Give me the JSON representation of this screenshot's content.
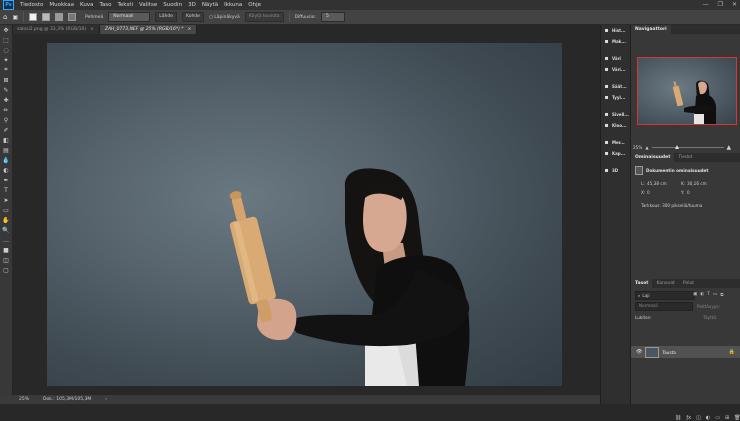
{
  "app": {
    "logo": "Ps"
  },
  "menu": [
    "Tiedosto",
    "Muokkaa",
    "Kuva",
    "Taso",
    "Teksti",
    "Valitse",
    "Suodin",
    "3D",
    "Näytä",
    "Ikkuna",
    "Ohje"
  ],
  "window_controls": {
    "minimize": "—",
    "restore": "❐",
    "close": "✕"
  },
  "options": {
    "blend_label": "Pehmeä",
    "mode_value": "Normaali",
    "btn1": "Lähde",
    "btn2": "Kohde",
    "transparent_label": "Läpinäkyvä",
    "pattern_label": "Käytä kuviota",
    "diffusion_label": "Diffuusio:",
    "diffusion_value": "5"
  },
  "tabs": [
    {
      "label": "salosi2.png @ 33,3% (RGB/16)",
      "close": "×"
    },
    {
      "label": "ZAH_0773,NEF @ 25% (RGB/16*) *",
      "close": "×"
    }
  ],
  "tools": [
    "move-icon",
    "marquee-icon",
    "lasso-icon",
    "magic-wand-icon",
    "crop-icon",
    "frame-icon",
    "eyedropper-icon",
    "healing-icon",
    "brush-icon",
    "stamp-icon",
    "history-brush-icon",
    "eraser-icon",
    "gradient-icon",
    "blur-icon",
    "dodge-icon",
    "pen-icon",
    "type-icon",
    "path-select-icon",
    "shape-icon",
    "hand-icon",
    "zoom-icon",
    "more-icon",
    "color-swatch",
    "mask-icon",
    "screen-mode-icon"
  ],
  "tool_glyphs": [
    "✥",
    "⬚",
    "◌",
    "✦",
    "⌗",
    "⊠",
    "✎",
    "✚",
    "✏",
    "⚲",
    "✐",
    "◧",
    "▤",
    "💧",
    "◐",
    "✒",
    "T",
    "➤",
    "▭",
    "✋",
    "🔍",
    "…",
    "■",
    "◫",
    "▢"
  ],
  "status": {
    "zoom": "25%",
    "doc": "Dok.: 105,3M/105,3M",
    "arrow": "›"
  },
  "iconcol": [
    {
      "name": "history",
      "label": "Hist..."
    },
    {
      "name": "actions",
      "label": "Mak..."
    },
    {
      "name": "color",
      "label": "Väri"
    },
    {
      "name": "swatches",
      "label": "Väri..."
    },
    {
      "name": "adjust",
      "label": "Säät..."
    },
    {
      "name": "styles",
      "label": "Tyyl..."
    },
    {
      "name": "brushes",
      "label": "Sivell..."
    },
    {
      "name": "clone-source",
      "label": "Kloo..."
    },
    {
      "name": "character",
      "label": "Mer..."
    },
    {
      "name": "paragraph",
      "label": "Kap..."
    },
    {
      "name": "3d",
      "label": "3D"
    }
  ],
  "navigator": {
    "tab": "Navigaattori",
    "zoom": "25%"
  },
  "properties": {
    "tab1": "Ominaisuudet",
    "tab2": "Tiedot",
    "section": "Dokumentin ominaisuudet",
    "w_label": "L:",
    "w_value": "45,38 cm",
    "h_label": "K:",
    "h_value": "30,16 cm",
    "x_label": "X:",
    "x_value": "0",
    "y_label": "Y:",
    "y_value": "0",
    "resolution": "Tarkkuus: 300 pikseliä/tuuma"
  },
  "layers": {
    "tabs": [
      "Tasot",
      "Kanavat",
      "Polut"
    ],
    "kind": "Laji",
    "mode": "Normaali",
    "opacity_label": "Peittävyys:",
    "lock_label": "Lukitse:",
    "fill_label": "Täyttö:",
    "layer_name": "Tausta"
  }
}
